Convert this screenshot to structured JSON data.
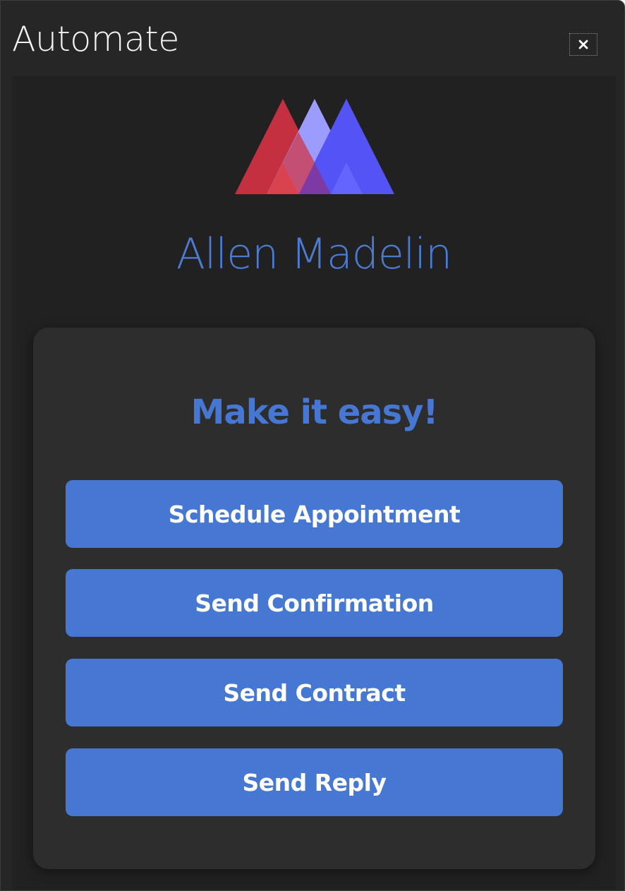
{
  "window": {
    "title": "Automate",
    "close_icon": "close-icon"
  },
  "brand": {
    "logo_icon": "triple-mountain-logo",
    "name": "Allen Madelin",
    "colors": {
      "red": "#c53040",
      "lavender": "#9c9cff",
      "blue": "#5454f6",
      "accent": "#4677d2"
    }
  },
  "card": {
    "heading": "Make it easy!",
    "buttons": [
      {
        "label": "Schedule Appointment"
      },
      {
        "label": "Send Confirmation"
      },
      {
        "label": "Send Contract"
      },
      {
        "label": "Send Reply"
      }
    ]
  }
}
